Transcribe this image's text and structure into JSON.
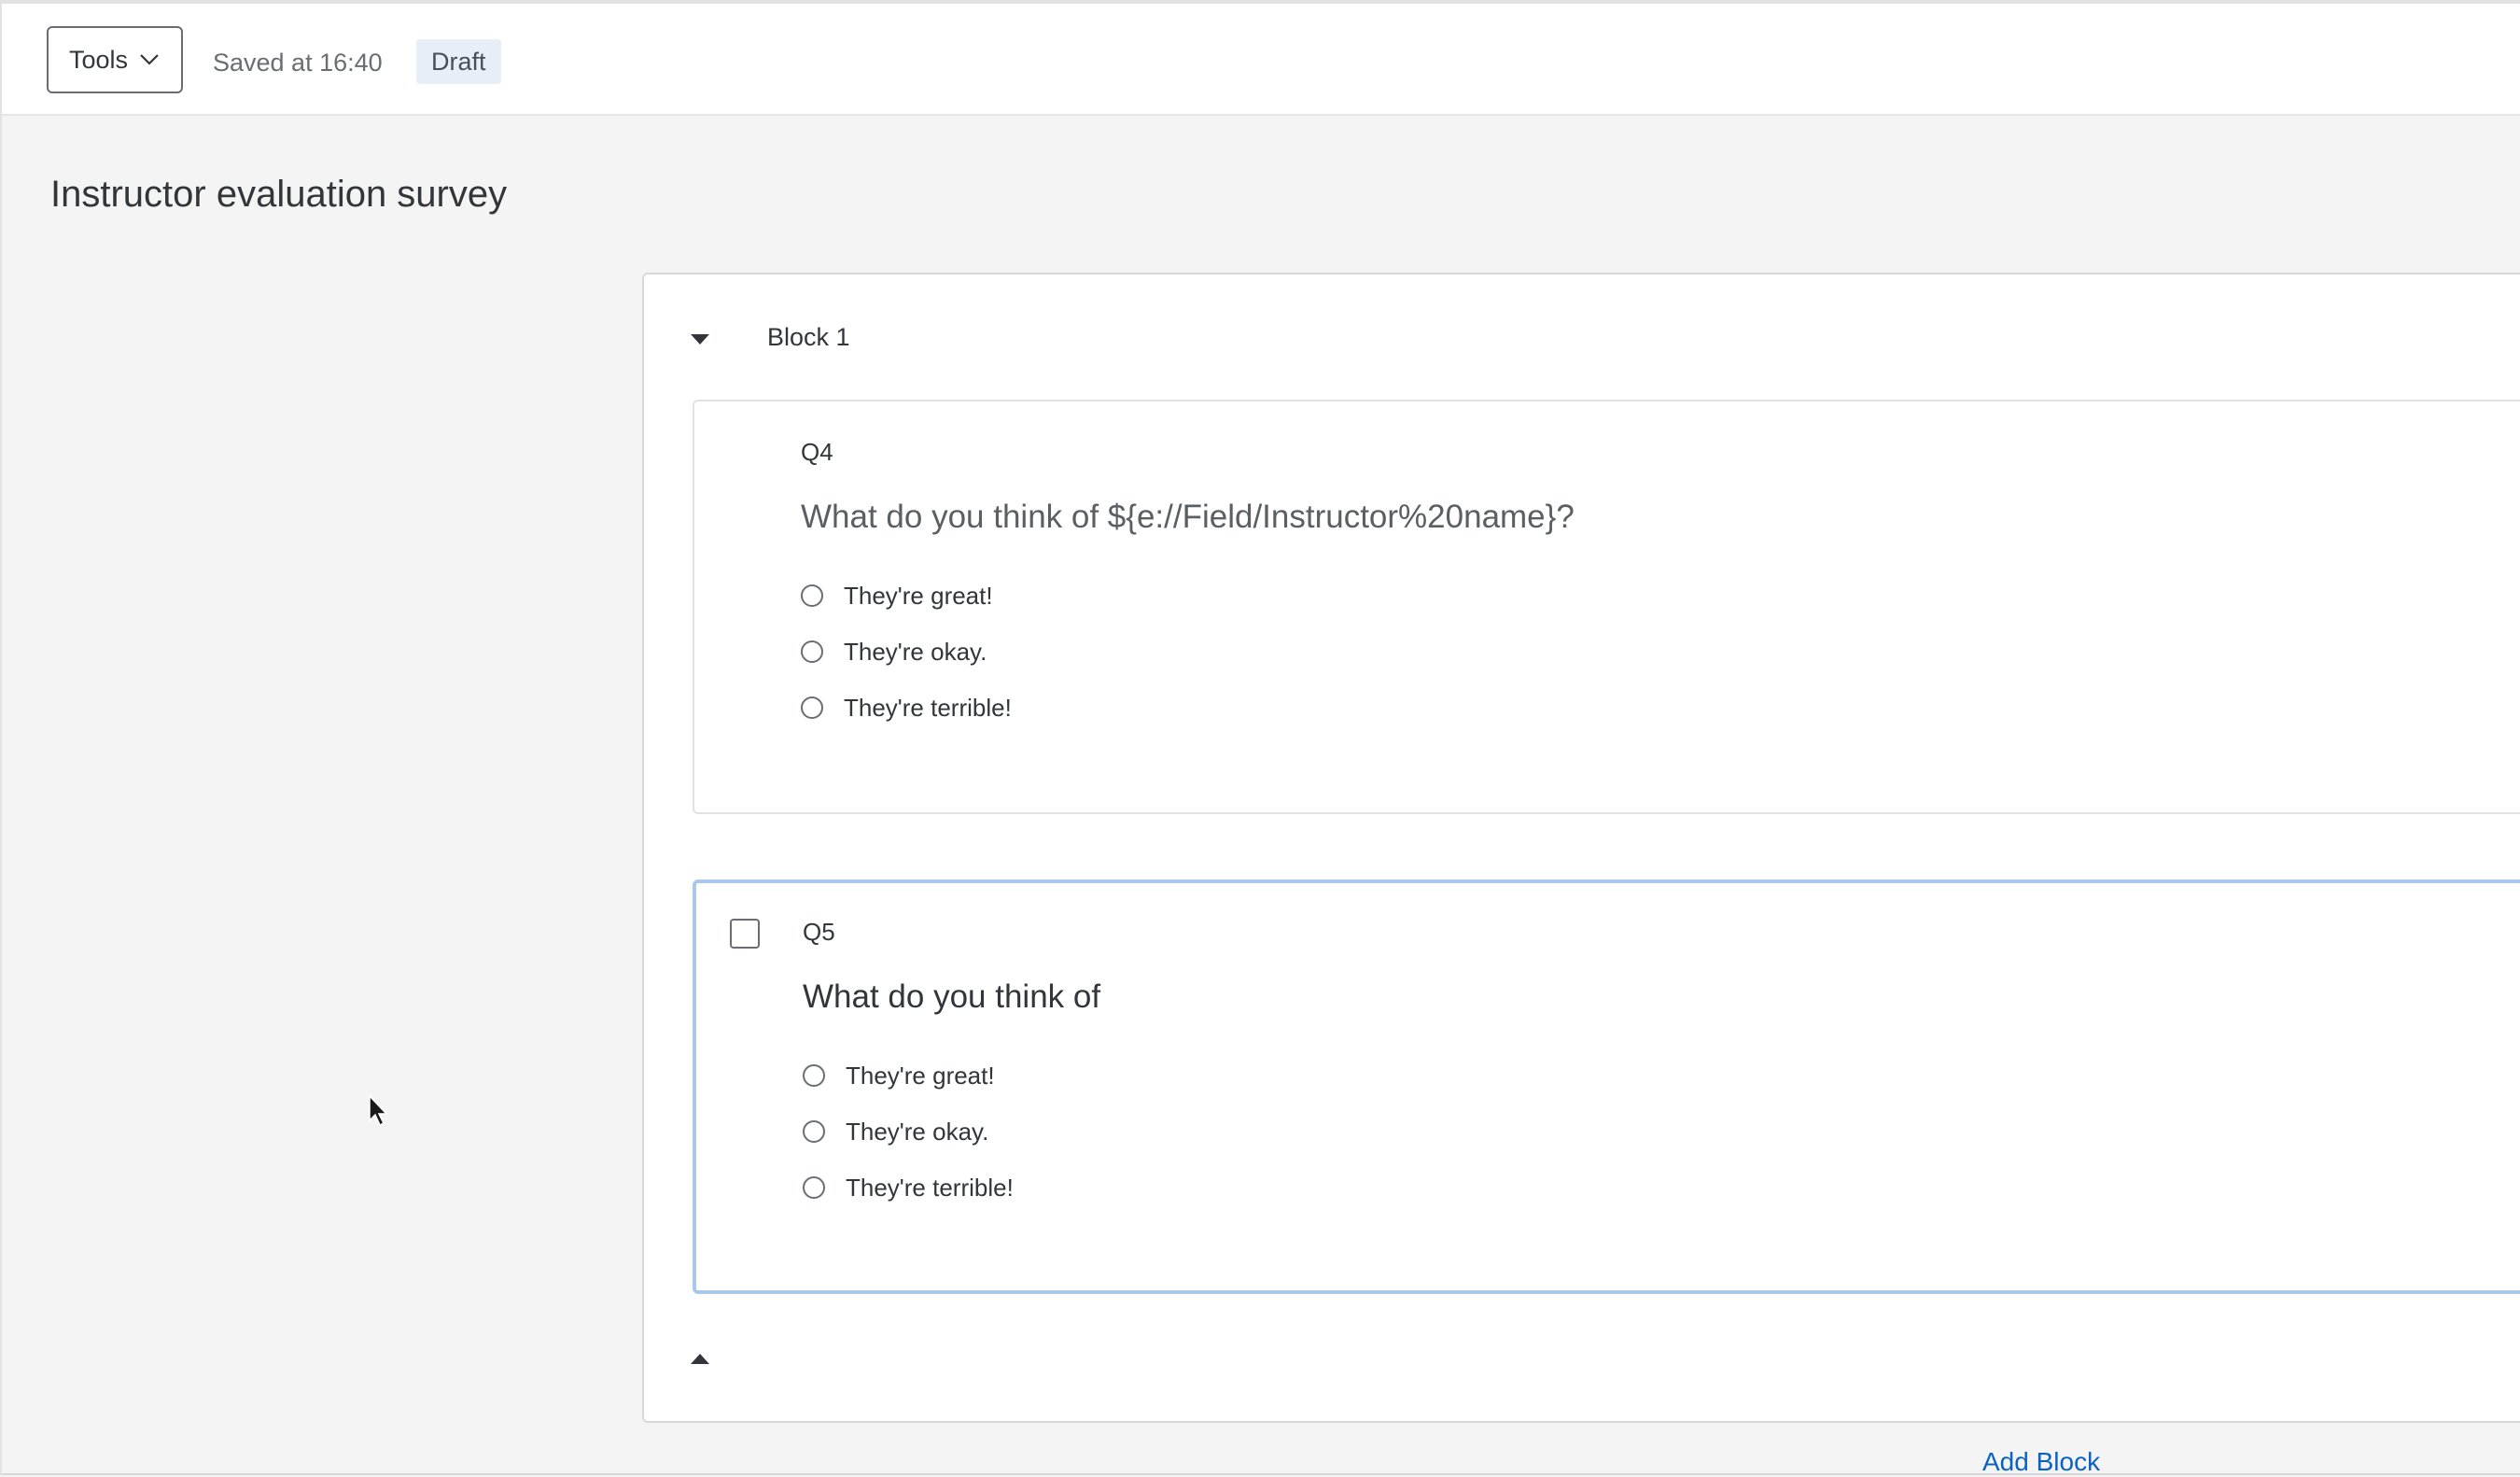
{
  "header": {
    "tools_label": "Tools",
    "saved_text": "Saved at 16:40",
    "status_badge": "Draft"
  },
  "survey": {
    "title": "Instructor evaluation survey"
  },
  "block": {
    "name": "Block 1",
    "questions": [
      {
        "label": "Q4",
        "text": "What do you think of ${e://Field/Instructor%20name}?",
        "choices": [
          "They're great!",
          "They're okay.",
          "They're terrible!"
        ]
      },
      {
        "label": "Q5",
        "text": "What do you think of",
        "choices": [
          "They're great!",
          "They're okay.",
          "They're terrible!"
        ]
      }
    ]
  },
  "footer": {
    "add_block_label": "Add Block"
  },
  "colors": {
    "link": "#0b63c1",
    "selected_question_border": "#a9c7e8",
    "badge_bg": "#e8eef5",
    "page_bg": "#f4f4f4"
  },
  "icons": {
    "tools_dropdown": "chevron-down-icon",
    "block_expand": "caret-down-icon",
    "block_collapse": "caret-up-icon",
    "pointer": "mouse-cursor-icon"
  }
}
